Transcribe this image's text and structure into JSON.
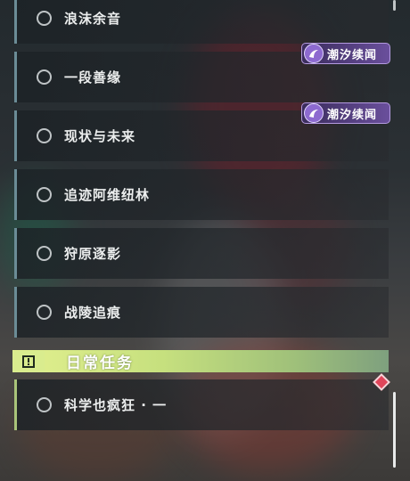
{
  "quest_list": {
    "items": [
      {
        "label": "浪沫余音"
      },
      {
        "label": "一段善缘"
      },
      {
        "label": "现状与未来"
      },
      {
        "label": "追迹阿维纽林"
      },
      {
        "label": "狩原逐影"
      },
      {
        "label": "战陵追痕"
      }
    ],
    "tidal_badges": [
      {
        "label": "潮汐续闻",
        "icon": "tidal-swirl-icon"
      },
      {
        "label": "潮汐续闻",
        "icon": "tidal-swirl-icon"
      }
    ]
  },
  "daily": {
    "header_title": "日常任务",
    "header_icon": "alert-box-icon",
    "items": [
      {
        "label": "科学也疯狂 · 一"
      }
    ],
    "marker_icon": "red-diamond-icon"
  },
  "colors": {
    "quest_accent": "#6b8c96",
    "daily_accent": "#c6e07e",
    "badge_purple": "#6a4f9c",
    "marker_red": "#e0455a"
  }
}
